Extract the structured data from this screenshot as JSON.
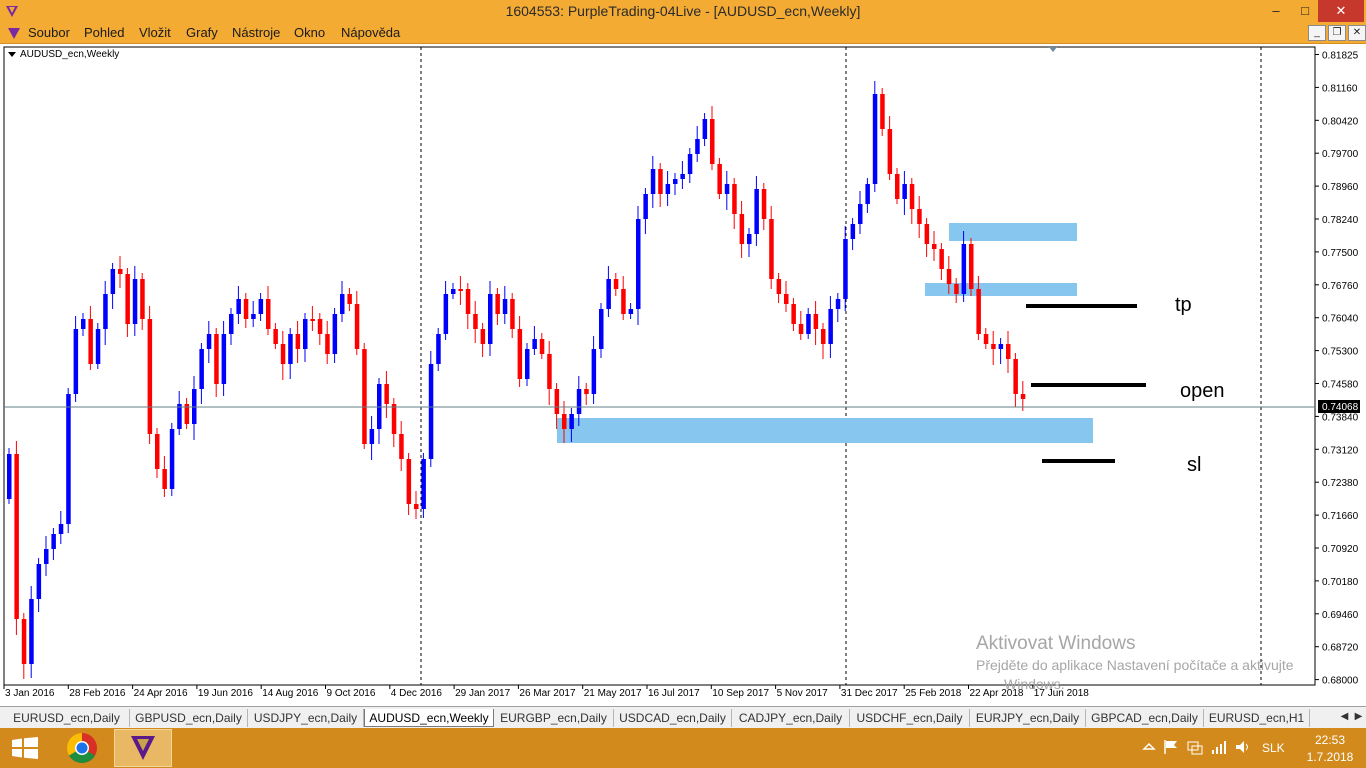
{
  "window": {
    "title": "1604553: PurpleTrading-04Live - [AUDUSD_ecn,Weekly]",
    "minimize": "–",
    "maximize": "□",
    "close": "✕"
  },
  "menu": {
    "items": [
      "Soubor",
      "Pohled",
      "Vložit",
      "Grafy",
      "Nástroje",
      "Okno",
      "Nápověda"
    ],
    "mdi_buttons": [
      "_",
      "❐",
      "✕"
    ]
  },
  "chart": {
    "symbol_label": "AUDUSD_ecn,Weekly",
    "current_price": "0.74068",
    "price_ticks": [
      "0.81825",
      "0.81160",
      "0.80420",
      "0.79700",
      "0.78960",
      "0.78240",
      "0.77500",
      "0.76760",
      "0.76040",
      "0.75300",
      "0.74580",
      "0.73840",
      "0.73120",
      "0.72380",
      "0.71660",
      "0.70920",
      "0.70180",
      "0.69460",
      "0.68720",
      "0.68000"
    ],
    "date_ticks": [
      "3 Jan 2016",
      "28 Feb 2016",
      "24 Apr 2016",
      "19 Jun 2016",
      "14 Aug 2016",
      "9 Oct 2016",
      "4 Dec 2016",
      "29 Jan 2017",
      "26 Mar 2017",
      "21 May 2017",
      "16 Jul 2017",
      "10 Sep 2017",
      "5 Nov 2017",
      "31 Dec 2017",
      "25 Feb 2018",
      "22 Apr 2018",
      "17 Jun 2018"
    ],
    "annotations": {
      "tp": "tp",
      "open": "open",
      "sl": "sl"
    },
    "colors": {
      "bull": "#0000ff",
      "bear": "#ff0000",
      "zone": "#87c6ef",
      "price_line": "#5f7f86"
    }
  },
  "watermark": {
    "title": "Aktivovat Windows",
    "line": "Přejděte do aplikace Nastavení počítače a aktivujte",
    "line2": "Windows."
  },
  "tabs": [
    {
      "label": "EURUSD_ecn,Daily",
      "active": false
    },
    {
      "label": "GBPUSD_ecn,Daily",
      "active": false
    },
    {
      "label": "USDJPY_ecn,Daily",
      "active": false
    },
    {
      "label": "AUDUSD_ecn,Weekly",
      "active": true
    },
    {
      "label": "EURGBP_ecn,Daily",
      "active": false
    },
    {
      "label": "USDCAD_ecn,Daily",
      "active": false
    },
    {
      "label": "CADJPY_ecn,Daily",
      "active": false
    },
    {
      "label": "USDCHF_ecn,Daily",
      "active": false
    },
    {
      "label": "EURJPY_ecn,Daily",
      "active": false
    },
    {
      "label": "GBPCAD_ecn,Daily",
      "active": false
    },
    {
      "label": "EURUSD_ecn,H1",
      "active": false
    }
  ],
  "taskbar": {
    "language": "SLK",
    "time": "22:53",
    "date": "1.7.2018",
    "apps": [
      "windows-start-icon",
      "chrome-icon",
      "metatrader-icon"
    ]
  }
}
